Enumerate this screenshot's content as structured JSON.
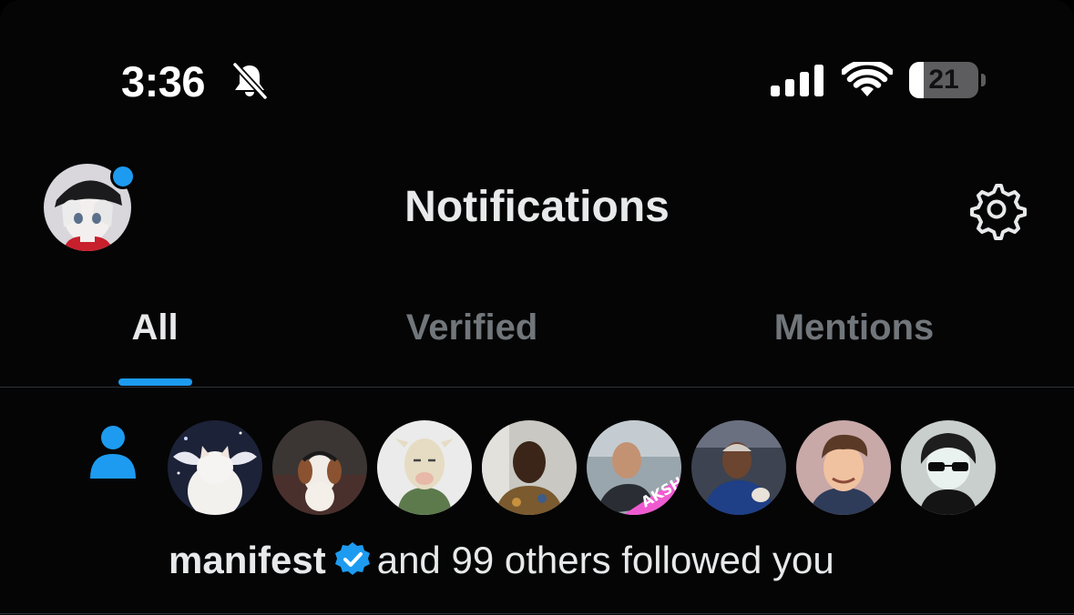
{
  "status_bar": {
    "time": "3:36",
    "battery_level": "21",
    "battery_fraction": 0.21,
    "icons": [
      "bell-slash-icon",
      "cellular-signal-icon",
      "wifi-icon",
      "battery-icon"
    ]
  },
  "header": {
    "title": "Notifications",
    "avatar_icon": "profile-avatar",
    "has_unread_dot": true,
    "settings_icon": "gear-icon"
  },
  "tabs": [
    {
      "label": "All",
      "active": true
    },
    {
      "label": "Verified",
      "active": false
    },
    {
      "label": "Mentions",
      "active": false
    }
  ],
  "notification": {
    "type_icon": "person-follow-icon",
    "avatar_count": 8,
    "name": "manifest",
    "verified": true,
    "text": "and 99 others followed you"
  },
  "colors": {
    "accent": "#1d9bf0",
    "background": "#050505",
    "text_primary": "#e7e9ea",
    "text_secondary": "#71767b",
    "divider": "#2f3336"
  }
}
